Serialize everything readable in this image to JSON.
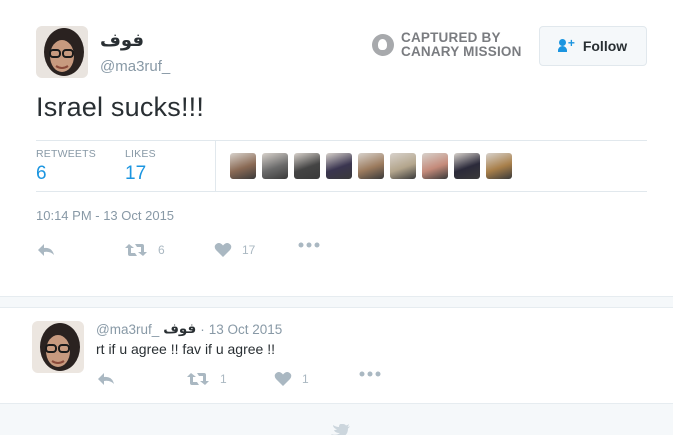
{
  "tweet": {
    "display_name": "فوف",
    "handle": "@ma3ruf_",
    "text": "Israel sucks!!!",
    "timestamp": "10:14 PM - 13 Oct 2015",
    "follow_label": "Follow",
    "retweets_label": "RETWEETS",
    "retweets_count": "6",
    "likes_label": "LIKES",
    "likes_count": "17",
    "action_retweet_count": "6",
    "action_like_count": "17"
  },
  "watermark": {
    "line1": "CAPTURED BY",
    "line2": "CANARY MISSION"
  },
  "likers": [
    {
      "icon": "liker-avatar",
      "color": "#8a6a55"
    },
    {
      "icon": "liker-avatar",
      "color": "#6b6b6b"
    },
    {
      "icon": "liker-avatar",
      "color": "#444444"
    },
    {
      "icon": "liker-avatar",
      "color": "#3a3550"
    },
    {
      "icon": "liker-avatar",
      "color": "#9c7b5e"
    },
    {
      "icon": "liker-avatar",
      "color": "#b3a58c"
    },
    {
      "icon": "liker-avatar",
      "color": "#c48a7a"
    },
    {
      "icon": "liker-avatar",
      "color": "#2b2a3a"
    },
    {
      "icon": "liker-avatar",
      "color": "#a87f4a"
    }
  ],
  "reply": {
    "handle": "@ma3ruf_",
    "display_name": "فوف",
    "separator": "·",
    "date": "13 Oct 2015",
    "text": "rt if u agree !! fav if u agree !!",
    "retweet_count": "1",
    "like_count": "1"
  },
  "colors": {
    "accent": "#1b95e0",
    "muted": "#8899a6",
    "icon": "#aab8c2"
  }
}
